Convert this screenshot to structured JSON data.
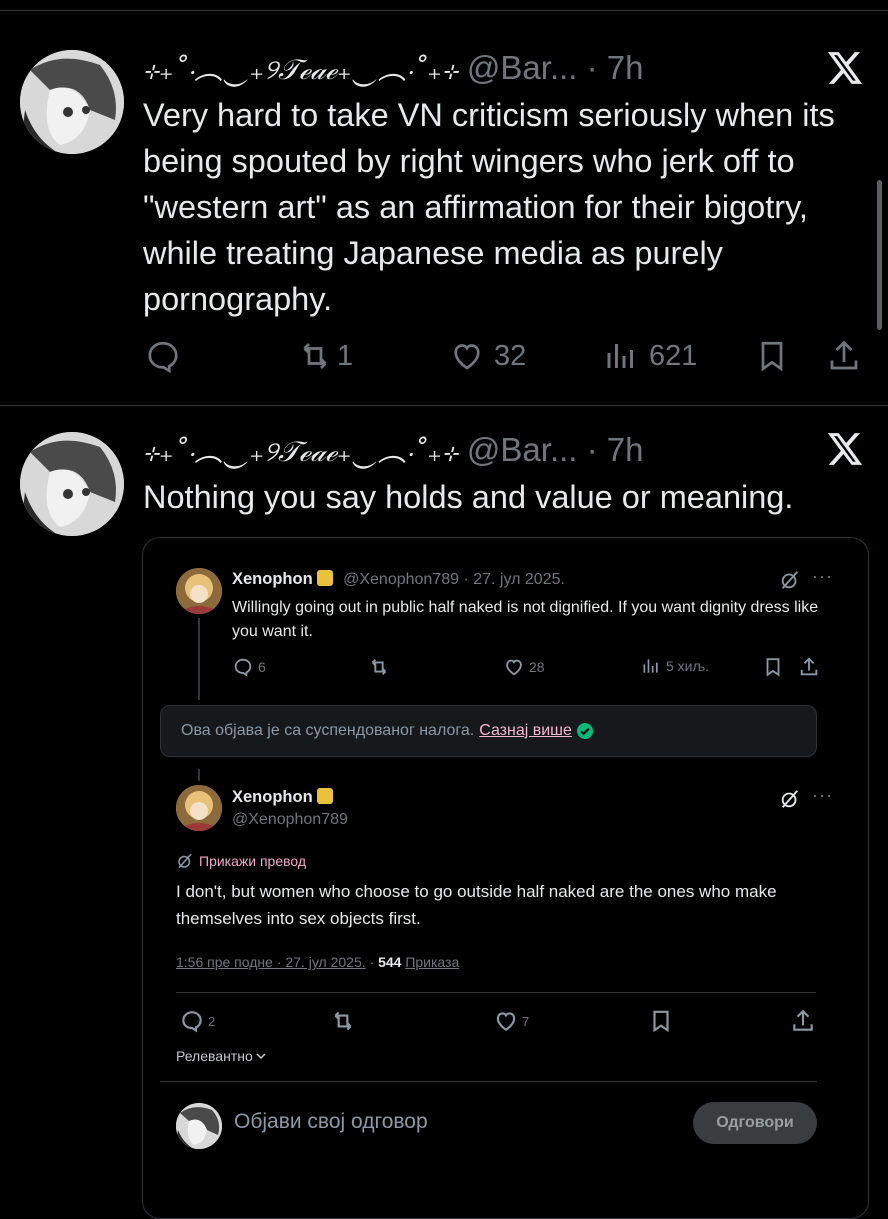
{
  "tweets": [
    {
      "display_name": "⊹₊˚‧︵‿₊୨𝒯ℯ𝒶ℯ₊‿︵‧˚₊⊹",
      "handle_time": "@Bar... · 7h",
      "text": "Very hard to take VN criticism seriously when its being spouted by right wingers who jerk off to \"western art\" as an affirmation for their bigotry, while treating Japanese media as purely pornography.",
      "actions": {
        "replies": "",
        "retweets": "1",
        "likes": "32",
        "views": "621"
      }
    },
    {
      "display_name": "⊹₊˚‧︵‿₊୨𝒯ℯ𝒶ℯ₊‿︵‧˚₊⊹",
      "handle_time": "@Bar... · 7h",
      "text": "Nothing you say holds and value or meaning."
    }
  ],
  "embedded": {
    "post1": {
      "name": "Xenophon",
      "handle_date": "@Xenophon789 · 27. јул 2025.",
      "text": "Willingly going out in public half naked is not dignified. If you want dignity dress like you want it.",
      "replies": "6",
      "likes": "28",
      "views": "5 хиљ."
    },
    "notice": {
      "text": "Ова објава је са суспендованог налога.",
      "link": "Сазнај више"
    },
    "post2": {
      "name": "Xenophon",
      "handle": "@Xenophon789",
      "translate": "Прикажи превод",
      "text": "I don't, but women who choose to go outside half naked are the ones who make themselves into sex objects first.",
      "timestamp": "1:56 пре подне · 27. јул 2025.",
      "views_count": "544",
      "views_label": "Приказа",
      "replies": "2",
      "likes": "7"
    },
    "sort_label": "Релевантно",
    "reply_placeholder": "Објави свој одговор",
    "reply_button": "Одговори"
  }
}
